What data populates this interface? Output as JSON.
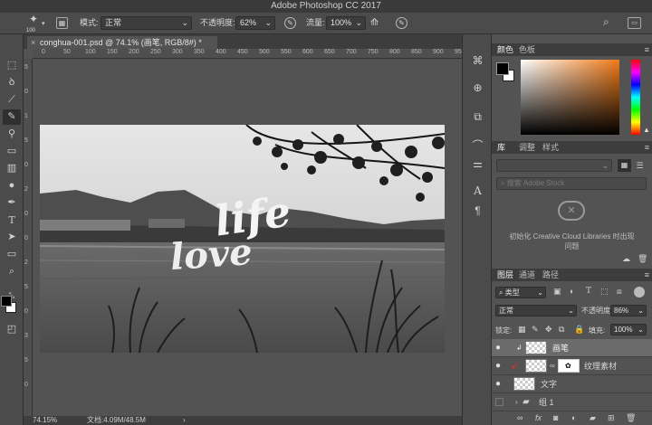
{
  "app_title": "Adobe Photoshop CC 2017",
  "options": {
    "brush_size": "100",
    "mode_label": "模式:",
    "mode_value": "正常",
    "opacity_label": "不透明度:",
    "opacity_value": "62%",
    "flow_label": "流量:",
    "flow_value": "100%"
  },
  "document": {
    "tab_title": "conghua-001.psd @ 74.1% (画笔, RGB/8#) *",
    "close_glyph": "×",
    "ruler_top": [
      "0",
      "50",
      "100",
      "150",
      "200",
      "250",
      "300",
      "350",
      "400",
      "450",
      "500",
      "550",
      "600",
      "650",
      "700",
      "750",
      "800",
      "850",
      "900",
      "950"
    ],
    "ruler_left": [
      "5",
      "0",
      "1",
      "5",
      "0",
      "2",
      "0",
      "0",
      "2",
      "5",
      "0",
      "3",
      "5",
      "0"
    ],
    "art_text_1": "life",
    "art_text_2": "love"
  },
  "status": {
    "zoom": "74.15%",
    "doc_size": "文档:4.09M/48.5M",
    "arrow": "›"
  },
  "color_panel": {
    "tab_color": "颜色",
    "tab_swatches": "色板",
    "foreground": "#000000",
    "background": "#ffffff"
  },
  "library_panel": {
    "tab_library": "库",
    "tab_adjust": "调整",
    "tab_style": "样式",
    "search_placeholder": "搜索 Adobe Stock",
    "init_message_1": "初始化 Creative Cloud Libraries 时出现",
    "init_message_2": "问题"
  },
  "layers_panel": {
    "tab_layers": "图层",
    "tab_channels": "通道",
    "tab_paths": "路径",
    "filter_kind": "类型",
    "blend_mode": "正常",
    "opacity_label": "不透明度:",
    "opacity_value": "86%",
    "lock_label": "锁定:",
    "fill_label": "填充:",
    "fill_value": "100%",
    "layers": [
      {
        "name": "画笔",
        "visible": true,
        "selected": true
      },
      {
        "name": "纹理素材",
        "visible": true,
        "selected": false
      },
      {
        "name": "文字",
        "visible": true,
        "selected": false
      },
      {
        "name": "组 1",
        "visible": false,
        "selected": false
      }
    ]
  },
  "icons": {
    "menu": "≡",
    "eye": "●"
  }
}
